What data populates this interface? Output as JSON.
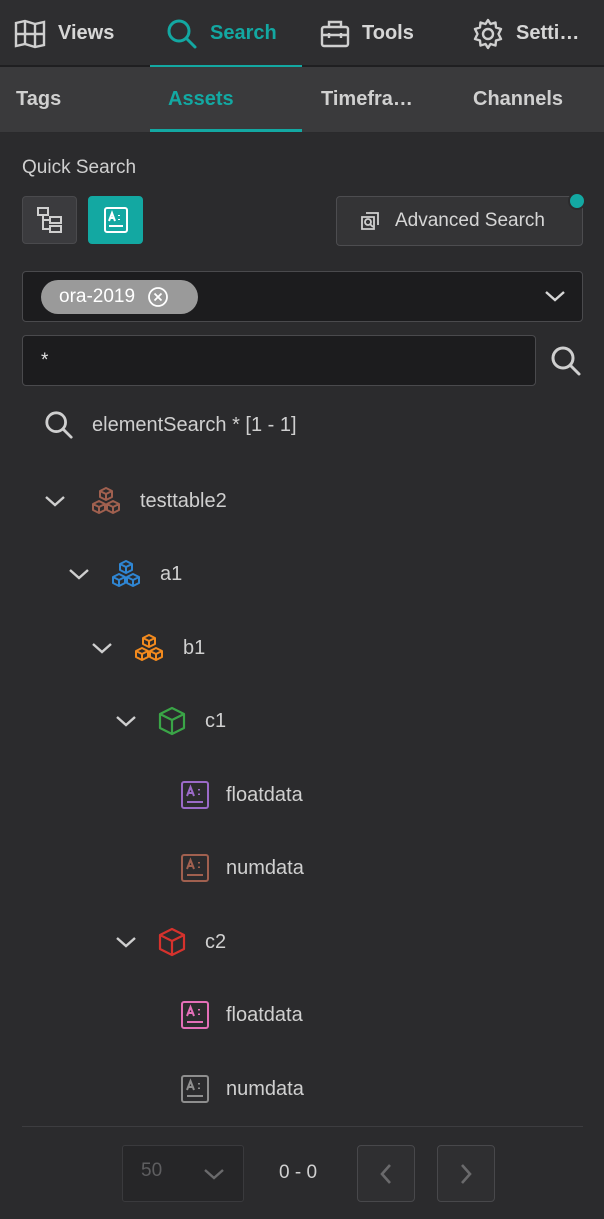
{
  "topnav": {
    "tabs": [
      {
        "label": "Views",
        "icon": "views-grid-icon"
      },
      {
        "label": "Search",
        "icon": "search-icon"
      },
      {
        "label": "Tools",
        "icon": "toolbox-icon"
      },
      {
        "label": "Setti…",
        "icon": "gear-icon"
      }
    ],
    "active": "Search"
  },
  "subnav": {
    "tabs": [
      "Tags",
      "Assets",
      "Timefra…",
      "Channels"
    ],
    "active": "Assets"
  },
  "quick_search": {
    "label": "Quick Search",
    "advanced_label": "Advanced Search"
  },
  "tag_filter": {
    "chip": "ora-2019"
  },
  "search": {
    "value": "*"
  },
  "results": {
    "summary": "elementSearch * [1 - 1]",
    "tree": {
      "root": {
        "label": "testtable2",
        "color": "#a0604f"
      },
      "a1": {
        "label": "a1",
        "color": "#2f86d3"
      },
      "b1": {
        "label": "b1",
        "color": "#f28a1e"
      },
      "c1": {
        "label": "c1",
        "color": "#3aa547"
      },
      "c1_floatdata": {
        "label": "floatdata",
        "color": "#9b6ac8"
      },
      "c1_numdata": {
        "label": "numdata",
        "color": "#a0604f"
      },
      "c2": {
        "label": "c2",
        "color": "#d6322d"
      },
      "c2_floatdata": {
        "label": "floatdata",
        "color": "#e46fb8"
      },
      "c2_numdata": {
        "label": "numdata",
        "color": "#8e8e8e"
      }
    }
  },
  "pagination": {
    "page_size": "50",
    "range": "0 - 0"
  },
  "colors": {
    "accent": "#13a8a2",
    "background": "#2b2b2d"
  }
}
